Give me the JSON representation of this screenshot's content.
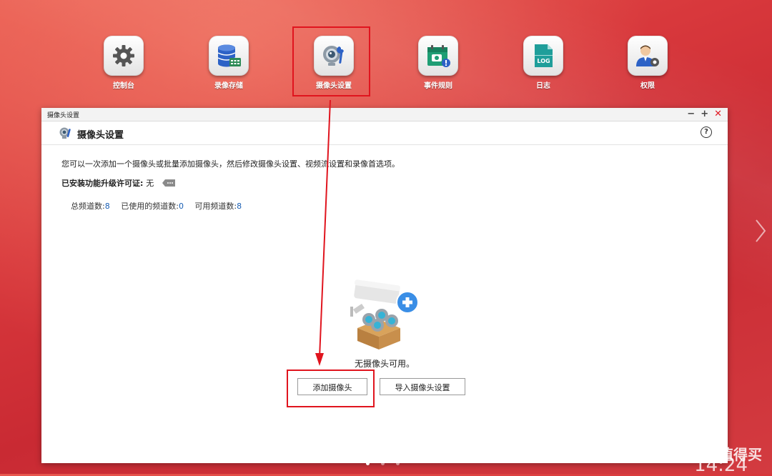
{
  "dock": [
    {
      "label": "控制台",
      "icon": "gear-icon"
    },
    {
      "label": "录像存储",
      "icon": "database-icon"
    },
    {
      "label": "摄像头设置",
      "icon": "camera-wrench-icon"
    },
    {
      "label": "事件规则",
      "icon": "calendar-alert-icon"
    },
    {
      "label": "日志",
      "icon": "log-file-icon",
      "icon_text": "LOG"
    },
    {
      "label": "权限",
      "icon": "user-gear-icon"
    }
  ],
  "window": {
    "titlebar": "摄像头设置",
    "controls": {
      "minimize": "−",
      "maximize": "+",
      "close": "✕"
    },
    "header_title": "摄像头设置",
    "help": "?",
    "description": "您可以一次添加一个摄像头或批量添加摄像头，然后修改摄像头设置、视频流设置和录像首选项。",
    "license_label": "已安装功能升级许可证:",
    "license_value": "无",
    "counts": {
      "total_label": "总频道数:",
      "total_value": "8",
      "used_label": "已使用的频道数:",
      "used_value": "0",
      "available_label": "可用频道数:",
      "available_value": "8"
    },
    "empty_text": "无摄像头可用。",
    "add_button": "添加摄像头",
    "import_button": "导入摄像头设置"
  },
  "colors": {
    "highlight": "#e0141e",
    "accent_blue": "#1a5fb4",
    "background": "#d33b40"
  },
  "watermark": "值 什么值得买",
  "clock": "14:24"
}
